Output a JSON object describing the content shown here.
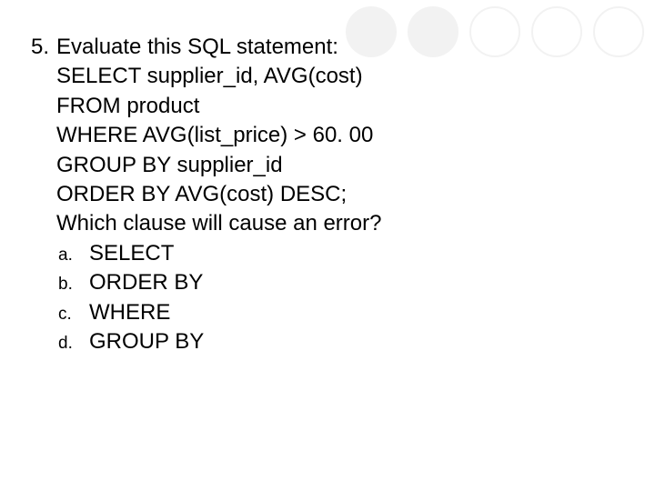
{
  "decor": {
    "circles": [
      {
        "fill": "#f2f2f2",
        "border": "none"
      },
      {
        "fill": "#f2f2f2",
        "border": "none"
      },
      {
        "fill": "#ffffff",
        "border": "2px solid #f2f2f2"
      },
      {
        "fill": "#ffffff",
        "border": "2px solid #f2f2f2"
      },
      {
        "fill": "#ffffff",
        "border": "2px solid #f2f2f2"
      }
    ]
  },
  "question": {
    "number": "5.",
    "stem_lines": [
      "Evaluate this SQL statement:",
      "SELECT supplier_id, AVG(cost)",
      "FROM product",
      "WHERE AVG(list_price) > 60. 00",
      "GROUP BY supplier_id",
      "ORDER BY AVG(cost) DESC;",
      "Which clause will cause an error?"
    ],
    "options": [
      {
        "letter": "a.",
        "text": "SELECT"
      },
      {
        "letter": "b.",
        "text": "ORDER BY"
      },
      {
        "letter": "c.",
        "text": "WHERE"
      },
      {
        "letter": "d.",
        "text": "GROUP BY"
      }
    ]
  }
}
